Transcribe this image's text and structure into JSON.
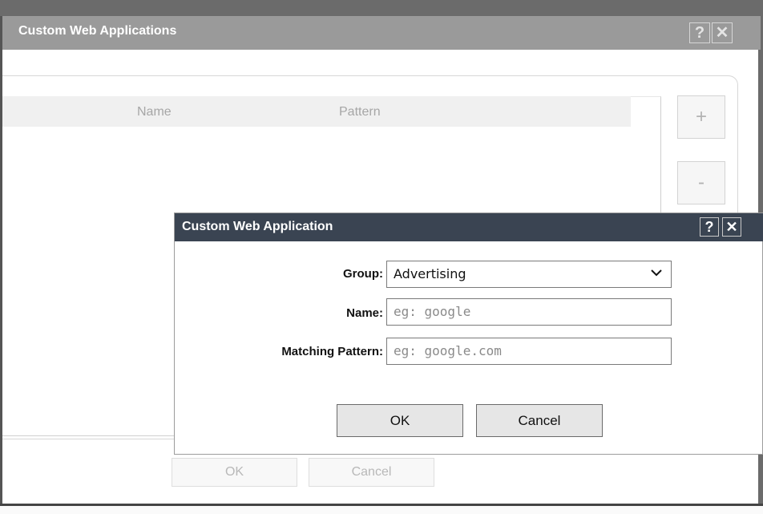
{
  "parent_window": {
    "title": "Custom Web Applications",
    "help_icon": "?",
    "close_icon": "✕",
    "table": {
      "columns": [
        "Name",
        "Pattern"
      ],
      "rows": []
    },
    "add_label": "+",
    "remove_label": "-",
    "ok_label": "OK",
    "cancel_label": "Cancel"
  },
  "dialog": {
    "title": "Custom Web Application",
    "help_icon": "?",
    "close_icon": "✕",
    "fields": {
      "group": {
        "label": "Group:",
        "value": "Advertising"
      },
      "name": {
        "label": "Name:",
        "placeholder": "eg: google",
        "value": ""
      },
      "pattern": {
        "label": "Matching Pattern:",
        "placeholder": "eg: google.com",
        "value": ""
      }
    },
    "ok_label": "OK",
    "cancel_label": "Cancel"
  }
}
